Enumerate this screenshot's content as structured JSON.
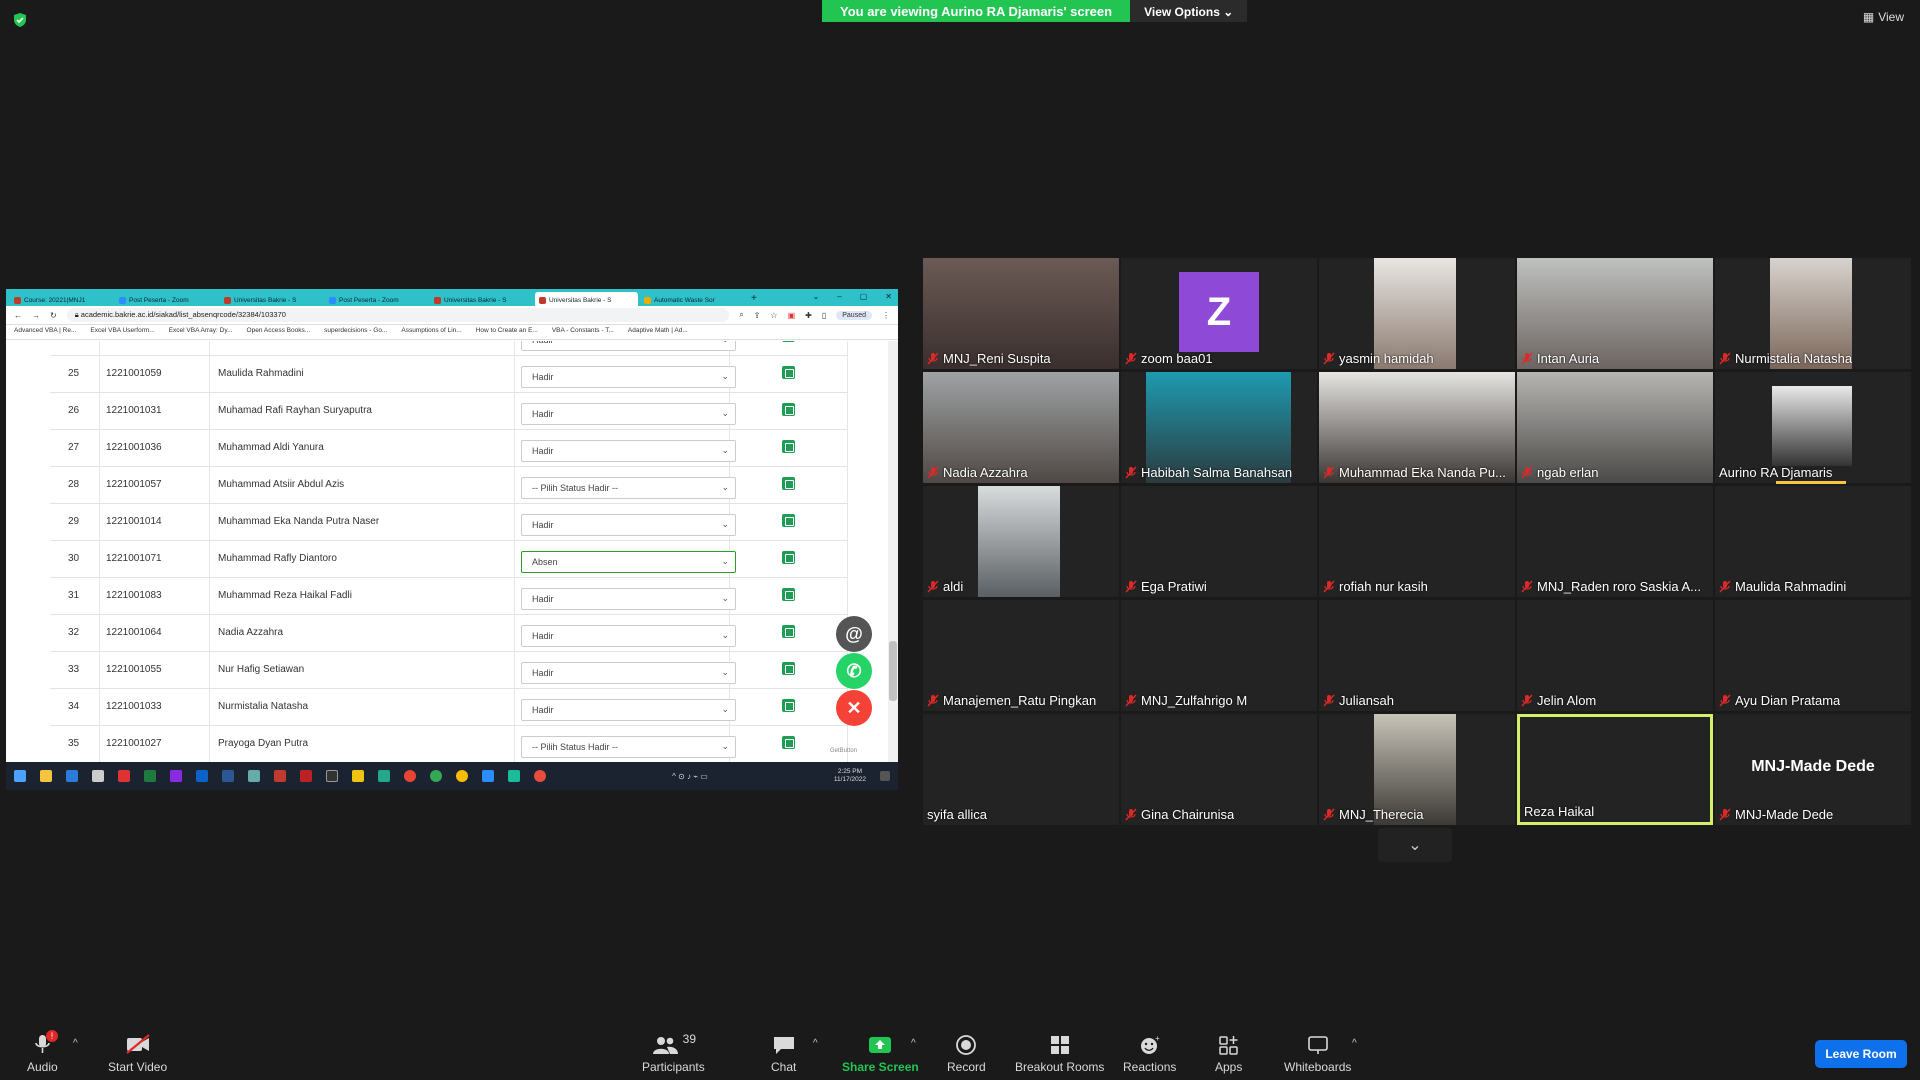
{
  "top": {
    "banner": "You are viewing Aurino RA Djamaris' screen",
    "view_options": "View Options",
    "view_label": "View"
  },
  "browser": {
    "tabs": [
      {
        "title": "Course: 20221|MNJ1"
      },
      {
        "title": "Post Peserta - Zoom"
      },
      {
        "title": "Universitas Bakrie - S"
      },
      {
        "title": "Post Peserta - Zoom"
      },
      {
        "title": "Universitas Bakrie - S"
      },
      {
        "title": "Universitas Bakrie - S"
      },
      {
        "title": "Automatic Waste Sor"
      }
    ],
    "url": "academic.bakrie.ac.id/siakad/list_absenqrcode/32384/103370",
    "paused": "Paused",
    "bookmarks": [
      "Advanced VBA | Re...",
      "Excel VBA Userform...",
      "Excel VBA Array: Dy...",
      "Open Access Books...",
      "superdecisions - Go...",
      "Assumptions of Lin...",
      "How to Create an E...",
      "VBA - Constants - T...",
      "Adaptive Math | Ad..."
    ],
    "rows": [
      {
        "no": "",
        "nim": "",
        "name": "",
        "status": "Hadir"
      },
      {
        "no": "25",
        "nim": "1221001059",
        "name": "Maulida Rahmadini",
        "status": "Hadir"
      },
      {
        "no": "26",
        "nim": "1221001031",
        "name": "Muhamad Rafi Rayhan Suryaputra",
        "status": "Hadir"
      },
      {
        "no": "27",
        "nim": "1221001036",
        "name": "Muhammad Aldi Yanura",
        "status": "Hadir"
      },
      {
        "no": "28",
        "nim": "1221001057",
        "name": "Muhammad Atsiir Abdul Azis",
        "status": "-- Pilih Status Hadir --"
      },
      {
        "no": "29",
        "nim": "1221001014",
        "name": "Muhammad Eka Nanda Putra Naser",
        "status": "Hadir"
      },
      {
        "no": "30",
        "nim": "1221001071",
        "name": "Muhammad Rafly Diantoro",
        "status": "Absen"
      },
      {
        "no": "31",
        "nim": "1221001083",
        "name": "Muhammad Reza Haikal Fadli",
        "status": "Hadir"
      },
      {
        "no": "32",
        "nim": "1221001064",
        "name": "Nadia Azzahra",
        "status": "Hadir"
      },
      {
        "no": "33",
        "nim": "1221001055",
        "name": "Nur Hafig Setiawan",
        "status": "Hadir"
      },
      {
        "no": "34",
        "nim": "1221001033",
        "name": "Nurmistalia Natasha",
        "status": "Hadir"
      },
      {
        "no": "35",
        "nim": "1221001027",
        "name": "Prayoga Dyan Putra",
        "status": "-- Pilih Status Hadir --"
      }
    ],
    "getbutton": "GetButton",
    "clock": {
      "time": "2:25 PM",
      "date": "11/17/2022"
    }
  },
  "participants": [
    {
      "name": "MNJ_Reni Suspita",
      "muted": true
    },
    {
      "name": "zoom baa01",
      "muted": true,
      "avatar": "Z"
    },
    {
      "name": "yasmin hamidah",
      "muted": true
    },
    {
      "name": "Intan Auria",
      "muted": true
    },
    {
      "name": "Nurmistalia Natasha",
      "muted": true
    },
    {
      "name": "Nadia Azzahra",
      "muted": true
    },
    {
      "name": "Habibah Salma Banahsan",
      "muted": true
    },
    {
      "name": "Muhammad Eka Nanda Pu...",
      "muted": true
    },
    {
      "name": "ngab erlan",
      "muted": true
    },
    {
      "name": "Aurino RA Djamaris",
      "muted": false
    },
    {
      "name": "aldi",
      "muted": true
    },
    {
      "name": "Ega Pratiwi",
      "muted": true
    },
    {
      "name": "rofiah nur kasih",
      "muted": true
    },
    {
      "name": "MNJ_Raden roro Saskia A...",
      "muted": true
    },
    {
      "name": "Maulida Rahmadini",
      "muted": true
    },
    {
      "name": "Manajemen_Ratu Pingkan",
      "muted": true
    },
    {
      "name": "MNJ_Zulfahrigo M",
      "muted": true
    },
    {
      "name": "Juliansah",
      "muted": true
    },
    {
      "name": "Jelin Alom",
      "muted": true
    },
    {
      "name": "Ayu Dian Pratama",
      "muted": true
    },
    {
      "name": "syifa allica",
      "muted": false
    },
    {
      "name": "Gina Chairunisa",
      "muted": true
    },
    {
      "name": "MNJ_Therecia",
      "muted": true
    },
    {
      "name": "Reza Haikal",
      "muted": false
    },
    {
      "name": "MNJ-Made Dede",
      "muted": true,
      "bigname": "MNJ-Made Dede"
    }
  ],
  "toolbar": {
    "audio": "Audio",
    "audio_badge": "!",
    "start_video": "Start Video",
    "participants": "Participants",
    "participants_count": "39",
    "chat": "Chat",
    "share_screen": "Share Screen",
    "record": "Record",
    "breakout_rooms": "Breakout Rooms",
    "reactions": "Reactions",
    "apps": "Apps",
    "whiteboards": "Whiteboards",
    "leave": "Leave Room"
  },
  "colors": {
    "share_green": "#23c552",
    "leave_blue": "#0e71eb",
    "speaker_border": "#d4ef6b",
    "mute_red": "#e02828"
  }
}
